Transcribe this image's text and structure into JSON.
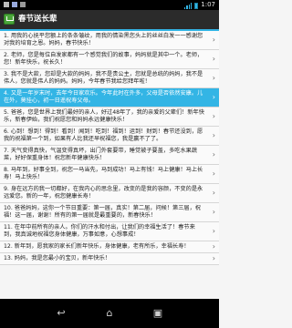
{
  "status": {
    "time": "1:07"
  },
  "header": {
    "title": "春节送长辈"
  },
  "items": [
    "1. 用我的心抚平您额上的条条皱纹，用我的情染黑您头上的丝丝白发一一感谢您对我的培育之恩。妈妈，春节快乐！",
    "2. 老师，您是每位自发家都有一个感觉我们的故事，妈妈就是其中一个。老师，您！新年快乐，祝长久！",
    "3. 我不是大款，您却是大款的妈妈，我不是贵公主，您就是总统的妈妈，我不是伟人，您就是伟人的妈妈。妈妈，今年春节我给您拜年啦！",
    "4. 又是一年岁末时，去年今日家欢乐。今年此时在外多，父母是否依然安康。儿在外，莫挂心，初一日遥祝寿父母。",
    "5. 爸爸，您是世界上我们最好的亲人，好过48年了，我的亲爱的父辈们！新年快乐，新春伊始，我们祝愿您和妈妈永远健康快乐！",
    "6. 心到！想到！得到！看到！闻到！吃到！福到！运到！财到！春节还没到，愿我的祝福第一个到，如果有人比我还早祝福您，我是赢不了了。",
    "7. 天气变得真快，气温变得真坏，出门外套要带，睡觉被子要盖，多吃水果蔬菜，好好保重身体！祝您新年健康快乐！",
    "8. 马年到，好事全到，祝您一马当先，马到成功！马上有钱！马上健康！马上长寿！马上快乐！",
    "9. 身在远方的我一切都好，在我内心的思念里，改变的是我的容颜，不变的是永远爱您。新的一年，祝您健康长寿！",
    "10. 爸爸妈妈，这你一个节日重要：第一届，真实！第二届，问候！第三届，祝福！这一届，谢谢！所有的第一届就是最重要的，新春快乐！",
    "11. 在年中前所有的亲人。你们的汗水和付出，让我们的幸福生活了！春节来到，我真诚地祝福您身体健康，万事如意，心想事成！",
    "12. 新年到，愿我家的家长们新年快乐，身体健康，老有所乐，幸福长寿！",
    "13. 妈妈，我是您最小的宝贝，新年快乐！"
  ]
}
